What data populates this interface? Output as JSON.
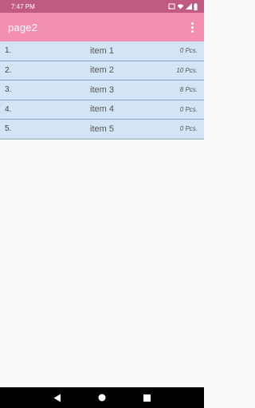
{
  "status_bar": {
    "time": "7:47 PM",
    "icons": [
      "cast-icon",
      "wifi-icon",
      "signal-icon",
      "battery-icon"
    ]
  },
  "app_bar": {
    "title": "page2",
    "menu_icon": "more-vert-icon"
  },
  "list": {
    "items": [
      {
        "index": "1.",
        "name": "item 1",
        "qty": "0 Pcs."
      },
      {
        "index": "2.",
        "name": "item 2",
        "qty": "10 Pcs."
      },
      {
        "index": "3.",
        "name": "item 3",
        "qty": "8 Pcs."
      },
      {
        "index": "4.",
        "name": "item 4",
        "qty": "0 Pcs."
      },
      {
        "index": "5.",
        "name": "item 5",
        "qty": "0 Pcs."
      }
    ]
  },
  "nav_bar": {
    "buttons": [
      "back-icon",
      "home-icon",
      "recents-icon"
    ]
  },
  "colors": {
    "status_bar": "#c15a83",
    "app_bar": "#f48fb1",
    "row_bg": "#d3e4f6"
  }
}
